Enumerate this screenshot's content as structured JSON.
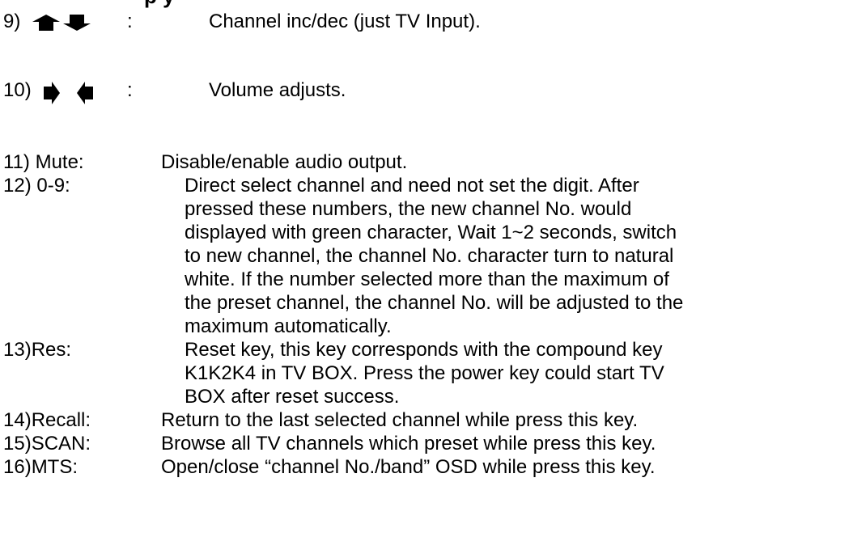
{
  "heading_fragment": "p        y",
  "items": [
    {
      "number": "9)",
      "separator": ":",
      "text": "Channel inc/dec (just TV Input).",
      "icons": [
        "arrow-up-icon",
        "arrow-down-icon"
      ]
    },
    {
      "number": "10)",
      "separator": ":",
      "text": "Volume adjusts.",
      "icons": [
        "arrow-right-icon",
        "arrow-left-icon"
      ]
    },
    {
      "number": "11) Mute:",
      "lines": [
        "Disable/enable audio output."
      ]
    },
    {
      "number": "12) 0-9:",
      "lines": [
        "Direct select channel and need not set the digit. After",
        "pressed these numbers, the new channel No. would",
        "displayed with green character, Wait 1~2 seconds, switch",
        "to new channel, the channel No. character turn to natural",
        "white. If the number selected more than the maximum of",
        "the preset channel, the channel No. will be adjusted to the",
        "maximum automatically."
      ]
    },
    {
      "number": "13)Res:",
      "lines": [
        "Reset key, this key corresponds with the compound key",
        "K1K2K4 in TV BOX. Press the power key could start TV",
        "BOX after reset success."
      ]
    },
    {
      "number": "14)Recall:",
      "lines": [
        "Return to the last selected channel while press this key."
      ]
    },
    {
      "number": "15)SCAN:",
      "lines": [
        "Browse all TV channels which preset while press this key."
      ]
    },
    {
      "number": "16)MTS:",
      "lines": [
        "Open/close “channel No./band” OSD while press this key."
      ]
    }
  ]
}
